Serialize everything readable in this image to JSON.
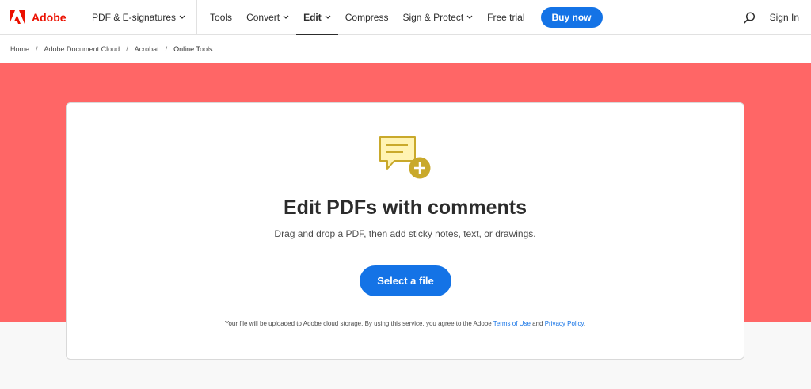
{
  "brand": {
    "name": "Adobe",
    "logo_icon": "adobe-logo-icon",
    "color": "#eb1000"
  },
  "nav": {
    "items": [
      {
        "label": "PDF & E-signatures",
        "dropdown": true
      },
      {
        "label": "Tools",
        "dropdown": false
      },
      {
        "label": "Convert",
        "dropdown": true
      },
      {
        "label": "Edit",
        "dropdown": true,
        "active": true
      },
      {
        "label": "Compress",
        "dropdown": false
      },
      {
        "label": "Sign & Protect",
        "dropdown": true
      },
      {
        "label": "Free trial",
        "dropdown": false
      }
    ],
    "buy_label": "Buy now",
    "search_icon": "search-icon",
    "signin_label": "Sign In"
  },
  "breadcrumb": [
    "Home",
    "Adobe Document Cloud",
    "Acrobat",
    "Online Tools"
  ],
  "hero_color": "#ff6666",
  "accent_color": "#1473e6",
  "card": {
    "icon": "comment-add-icon",
    "title": "Edit PDFs with comments",
    "subtitle": "Drag and drop a PDF, then add sticky notes, text, or drawings.",
    "button_label": "Select a file",
    "legal_prefix": "Your file will be uploaded to Adobe cloud storage.  By using this service, you agree to the Adobe ",
    "terms_label": "Terms of Use",
    "legal_and": " and ",
    "privacy_label": "Privacy Policy",
    "legal_suffix": "."
  }
}
